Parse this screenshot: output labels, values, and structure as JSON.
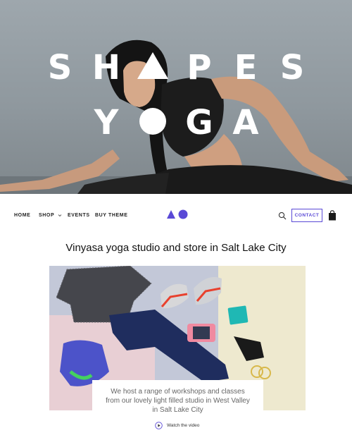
{
  "hero": {
    "logo_row1": [
      "S",
      "H",
      "",
      "P",
      "E",
      "S"
    ],
    "logo_row2": [
      "Y",
      "",
      "G",
      "A"
    ]
  },
  "nav": {
    "items": [
      {
        "label": "HOME"
      },
      {
        "label": "SHOP",
        "has_dropdown": true
      },
      {
        "label": "EVENTS"
      },
      {
        "label": "BUY THEME"
      }
    ],
    "contact_label": "CONTACT",
    "icons": [
      "search-icon",
      "shopping-bag-icon",
      "chevron-down-icon"
    ]
  },
  "headline": "Vinyasa yoga studio and store in Salt Lake City",
  "info_card": {
    "text": "We host a range of workshops and classes from our lovely light filled studio in West Valley in Salt Lake City",
    "watch_label": "Watch the video"
  },
  "colors": {
    "accent": "#5a49d6",
    "hero_bg": "#8f989e",
    "text": "#111111"
  }
}
